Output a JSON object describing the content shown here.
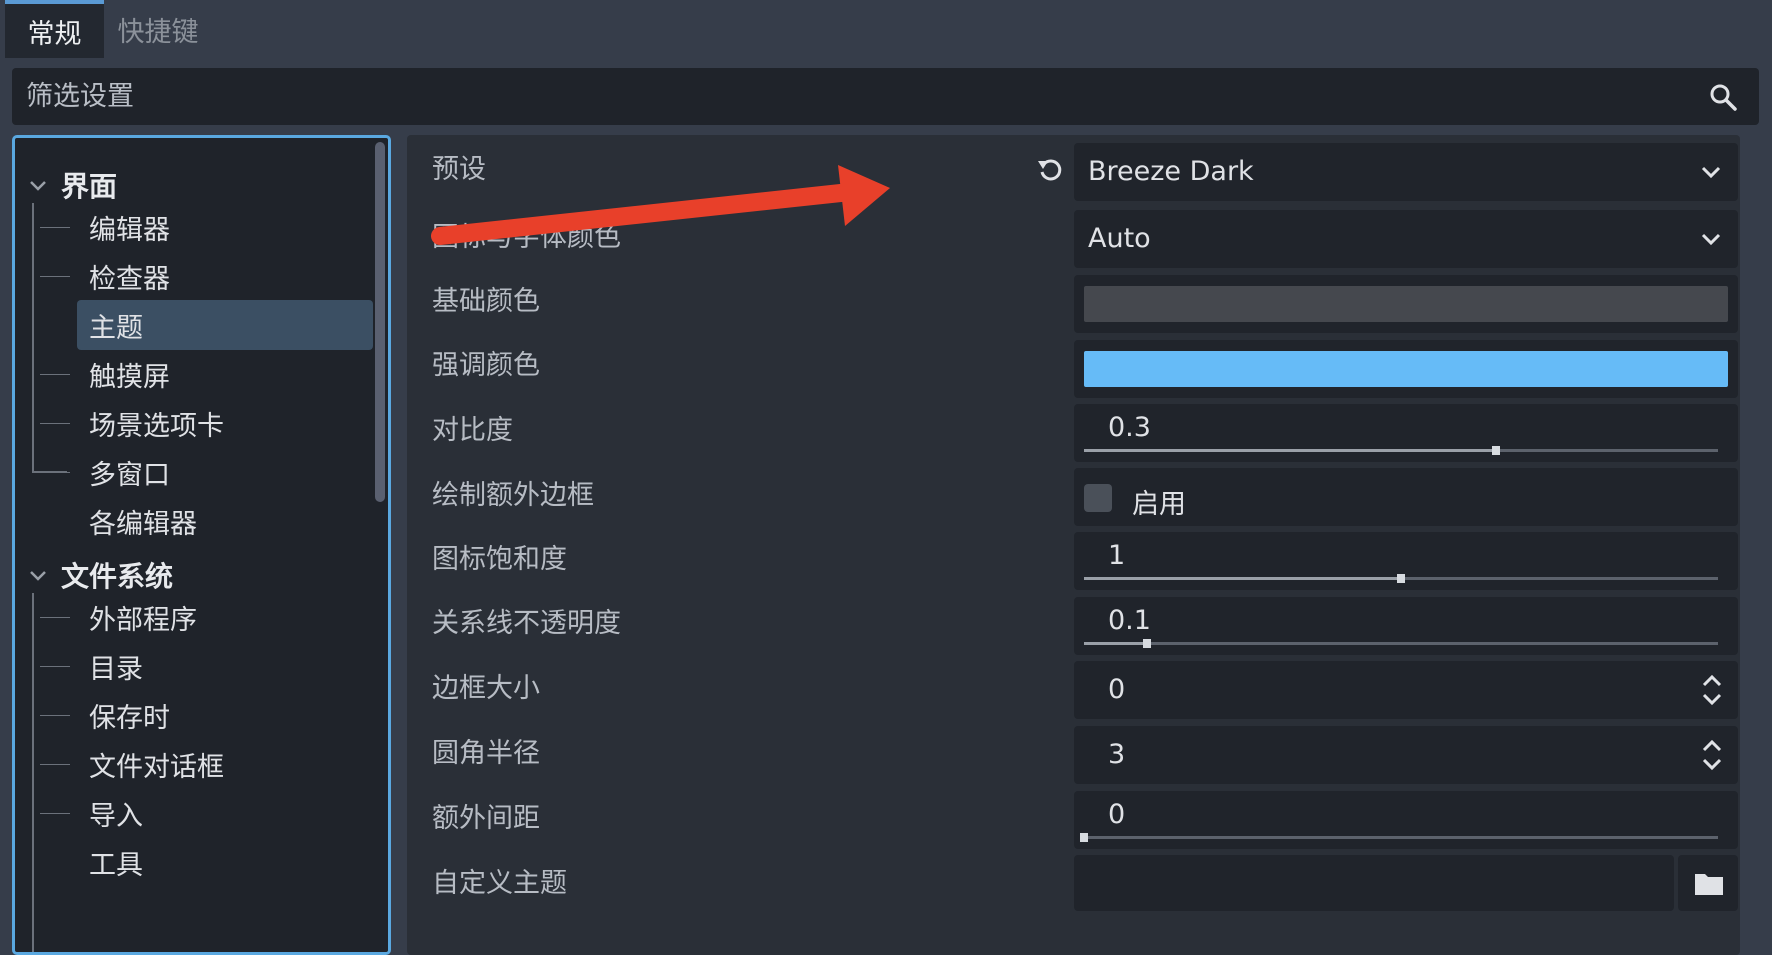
{
  "tabs": [
    {
      "label": "常规",
      "active": true
    },
    {
      "label": "快捷键",
      "active": false
    }
  ],
  "search": {
    "placeholder": "筛选设置"
  },
  "sidebar": {
    "categories": [
      {
        "label": "界面",
        "expanded": true,
        "items": [
          "编辑器",
          "检查器",
          "主题",
          "触摸屏",
          "场景选项卡",
          "多窗口",
          "各编辑器"
        ]
      },
      {
        "label": "文件系统",
        "expanded": true,
        "items": [
          "外部程序",
          "目录",
          "保存时",
          "文件对话框",
          "导入",
          "工具"
        ]
      }
    ],
    "selected_item": "主题"
  },
  "settings": {
    "preset": {
      "label": "预设",
      "value": "Breeze Dark"
    },
    "icon_font_color": {
      "label": "图标与字体颜色",
      "value": "Auto"
    },
    "base_color": {
      "label": "基础颜色",
      "color": "#45484e"
    },
    "accent_color": {
      "label": "强调颜色",
      "color": "#66bbf7"
    },
    "contrast": {
      "label": "对比度",
      "value": "0.3",
      "fraction": 0.65
    },
    "draw_extra_borders": {
      "label": "绘制额外边框",
      "checkbox_label": "启用",
      "checked": false
    },
    "icon_saturation": {
      "label": "图标饱和度",
      "value": "1",
      "fraction": 0.5
    },
    "relationship_line_opacity": {
      "label": "关系线不透明度",
      "value": "0.1",
      "fraction": 0.1
    },
    "border_size": {
      "label": "边框大小",
      "value": "0"
    },
    "corner_radius": {
      "label": "圆角半径",
      "value": "3"
    },
    "additional_spacing": {
      "label": "额外间距",
      "value": "0",
      "fraction": 0.0
    },
    "custom_theme": {
      "label": "自定义主题",
      "value": ""
    }
  },
  "icons": {
    "search": "search-icon",
    "revert": "revert-icon",
    "folder": "folder-icon",
    "dropdown": "chevron-down-icon",
    "spin": "spin-arrows-icon"
  },
  "colors": {
    "accent": "#5aa8e0",
    "annotation_arrow": "#e8402a"
  }
}
